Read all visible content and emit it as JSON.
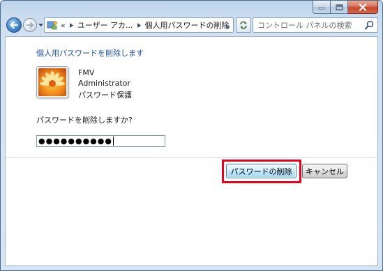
{
  "window": {
    "caption_buttons": [
      {
        "name": "minimize",
        "icon": "minimize-icon"
      },
      {
        "name": "maximize",
        "icon": "maximize-icon"
      },
      {
        "name": "close",
        "icon": "close-icon"
      }
    ]
  },
  "nav": {
    "back_icon": "arrow-left-icon",
    "forward_icon": "arrow-right-icon",
    "overflow": "«",
    "breadcrumb": [
      "ユーザー アカ...",
      "個人用パスワードの削除"
    ],
    "search_placeholder": "コントロール パネルの検索"
  },
  "main": {
    "title": "個人用パスワードを削除します",
    "user": {
      "name": "FMV",
      "role": "Administrator",
      "status": "パスワード保護"
    },
    "question": "パスワードを削除しますか?",
    "password_value": "●●●●●●●●●●",
    "buttons": {
      "remove": "パスワードの削除",
      "cancel": "キャンセル"
    }
  },
  "colors": {
    "title_blue": "#1d4e9e",
    "highlight_red": "#e8001c",
    "primary_button_border": "#3c7fb1"
  }
}
